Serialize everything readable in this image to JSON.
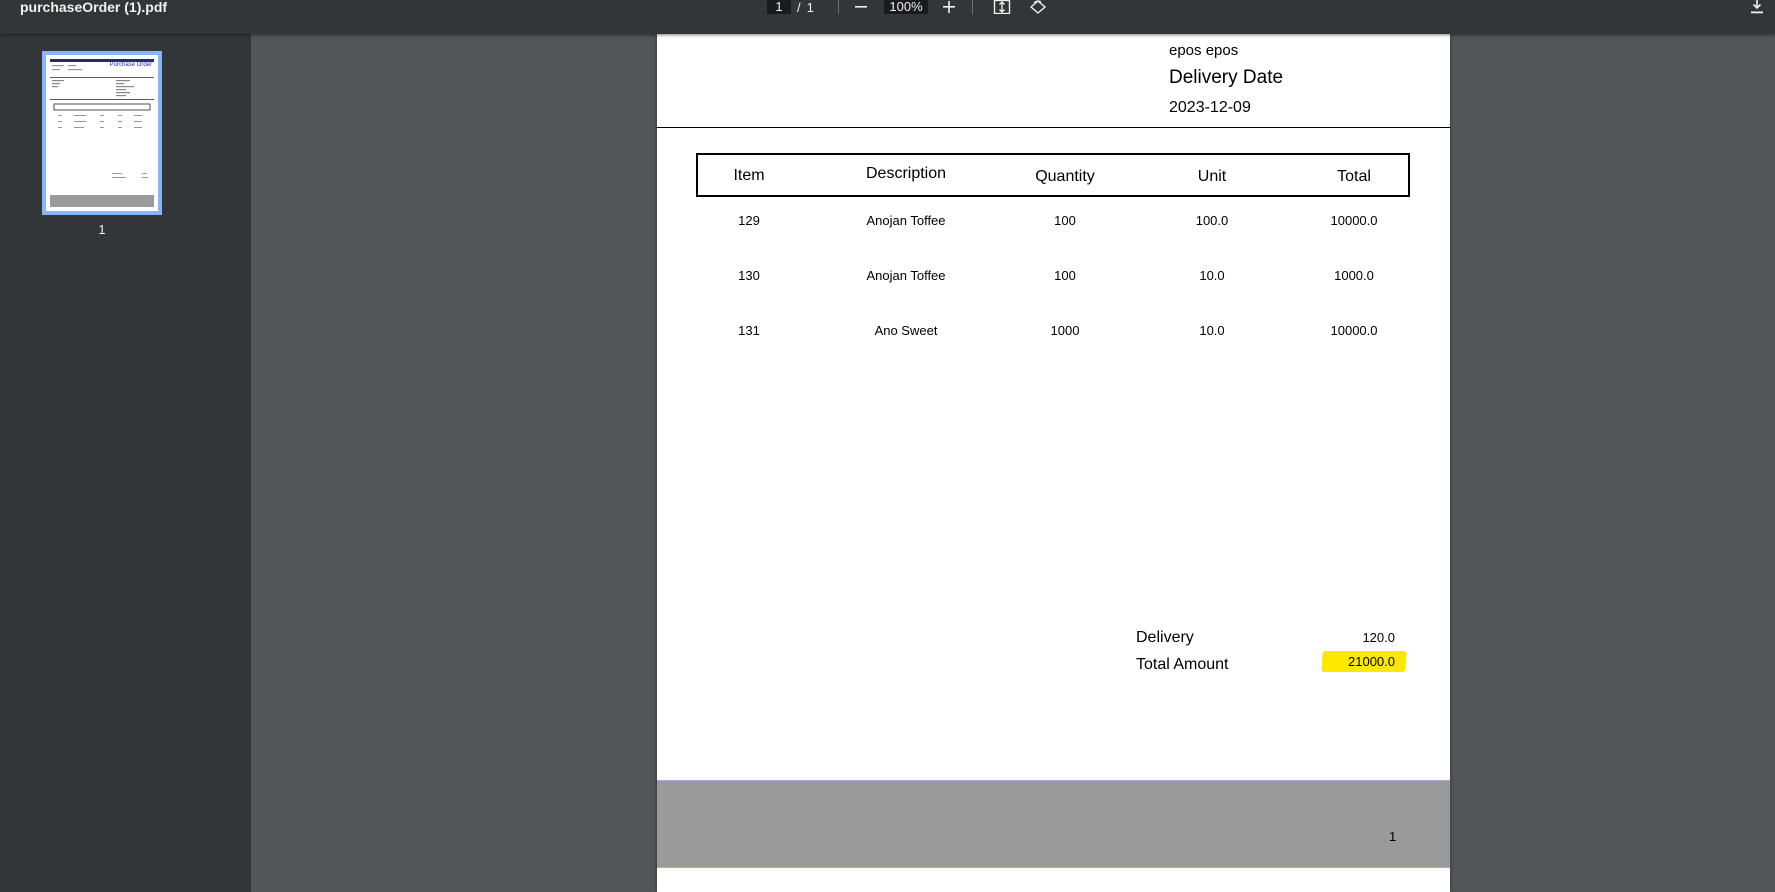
{
  "toolbar": {
    "title": "purchaseOrder (1).pdf",
    "page_current": "1",
    "page_separator": "/",
    "page_total": "1",
    "zoom": "100%",
    "icons": {
      "zoom_out": "minus-icon",
      "zoom_in": "plus-icon",
      "fit": "fit-page-icon",
      "rotate": "rotate-icon",
      "download": "download-icon"
    }
  },
  "sidebar": {
    "thumbnail_label": "1",
    "thumbnail_title": "Purchase Order"
  },
  "page": {
    "top_cut_text": "null",
    "supplier_name": "epos epos",
    "delivery_date_label": "Delivery Date",
    "delivery_date": "2023-12-09",
    "table": {
      "headers": [
        "Item",
        "Description",
        "Quantity",
        "Unit",
        "Total"
      ],
      "rows": [
        [
          "129",
          "Anojan Toffee",
          "100",
          "100.0",
          "10000.0"
        ],
        [
          "130",
          "Anojan Toffee",
          "100",
          "10.0",
          "1000.0"
        ],
        [
          "131",
          "Ano Sweet",
          "1000",
          "10.0",
          "10000.0"
        ]
      ]
    },
    "summary": {
      "delivery_label": "Delivery",
      "delivery_value": "120.0",
      "total_label": "Total Amount",
      "total_value": "21000.0",
      "highlight_color": "#ffe800"
    },
    "footer_page_number": "1"
  }
}
